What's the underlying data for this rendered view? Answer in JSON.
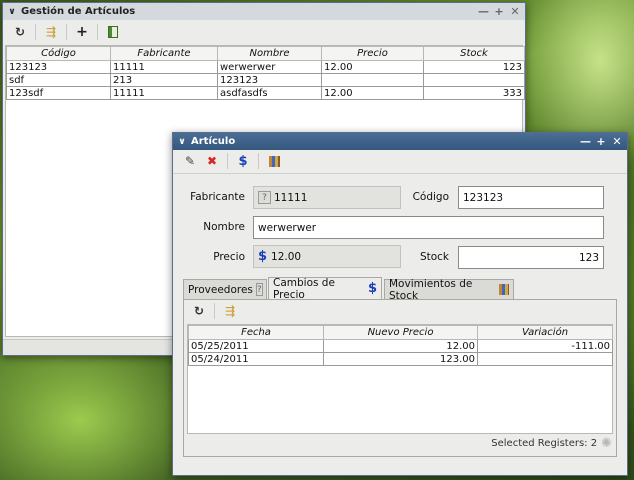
{
  "gestion": {
    "title": "Gestión de Artículos",
    "window_buttons": [
      "∨",
      "—",
      "+",
      "✕"
    ],
    "toolbar": [
      "refresh-icon",
      "filter-icon",
      "add-icon",
      "report-icon"
    ],
    "columns": [
      "Código",
      "Fabricante",
      "Nombre",
      "Precio",
      "Stock"
    ],
    "rows": [
      [
        "123123",
        "11111",
        "werwerwer",
        "12.00",
        "123"
      ],
      [
        "sdf",
        "213",
        "123123",
        "",
        ""
      ],
      [
        "123sdf",
        "11111",
        "asdfasdfs",
        "12.00",
        "333"
      ]
    ]
  },
  "articulo": {
    "title": "Artículo",
    "window_buttons": [
      "∨",
      "—",
      "+",
      "✕"
    ],
    "toolbar": [
      "edit-icon",
      "delete-icon",
      "price-icon",
      "stock-icon"
    ],
    "fabricante_label": "Fabricante",
    "fabricante_value": "11111",
    "codigo_label": "Código",
    "codigo_value": "123123",
    "nombre_label": "Nombre",
    "nombre_value": "werwerwer",
    "precio_label": "Precio",
    "precio_value": "12.00",
    "stock_label": "Stock",
    "stock_value": "123",
    "tabs": [
      "Proveedores",
      "Cambios de Precio",
      "Movimientos de Stock"
    ],
    "active_tab": "Cambios de Precio",
    "subtoolbar": [
      "refresh-icon",
      "filter-icon"
    ],
    "price_columns": [
      "Fecha",
      "Nuevo Precio",
      "Variación"
    ],
    "price_rows": [
      [
        "05/25/2011",
        "12.00",
        "-111.00"
      ],
      [
        "05/24/2011",
        "123.00",
        ""
      ]
    ],
    "status": "Selected Registers: 2"
  },
  "colors": {
    "titlebar_gestion": "#d2d7dc",
    "titlebar_articulo": "#3d5f85",
    "window_bg": "#ececea"
  }
}
